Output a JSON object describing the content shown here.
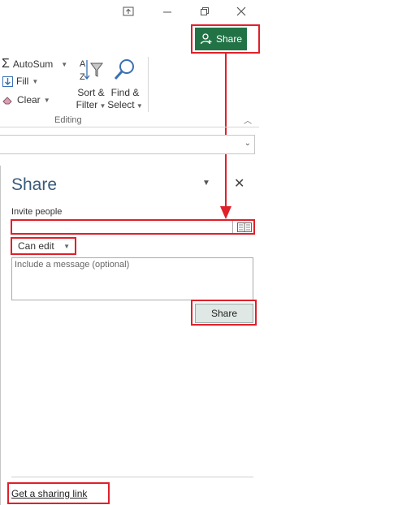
{
  "window": {
    "restore_icon": "ribbon-display-icon",
    "minimize_icon": "minimize-icon",
    "maximize_icon": "restore-icon",
    "close_icon": "close-icon"
  },
  "header": {
    "share_label": "Share",
    "share_icon": "person-add-icon"
  },
  "ribbon": {
    "autosum": "AutoSum",
    "fill": "Fill",
    "clear": "Clear",
    "sort_filter_line1": "Sort &",
    "sort_filter_line2": "Filter",
    "find_select_line1": "Find &",
    "find_select_line2": "Select",
    "group_label": "Editing"
  },
  "pane": {
    "title": "Share",
    "invite_label": "Invite people",
    "invite_value": "",
    "permission": "Can edit",
    "message_placeholder": "Include a message (optional)",
    "share_button": "Share",
    "sharing_link": "Get a sharing link"
  },
  "colors": {
    "accent": "#217346",
    "highlight": "#e0202a"
  }
}
